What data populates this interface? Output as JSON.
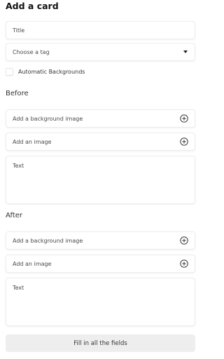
{
  "header": {
    "title": "Add a card"
  },
  "form": {
    "title_placeholder": "Title",
    "tag_placeholder": "Choose a tag",
    "automatic_backgrounds_label": "Automatic Backgrounds"
  },
  "before": {
    "heading": "Before",
    "background_image_label": "Add a background image",
    "image_label": "Add an image",
    "text_placeholder": "Text"
  },
  "after": {
    "heading": "After",
    "background_image_label": "Add a background image",
    "image_label": "Add an image",
    "text_placeholder": "Text"
  },
  "submit": {
    "label": "Fill in all the fields"
  },
  "icons": {
    "add": "plus-circle-icon",
    "dropdown": "caret-down-icon"
  }
}
